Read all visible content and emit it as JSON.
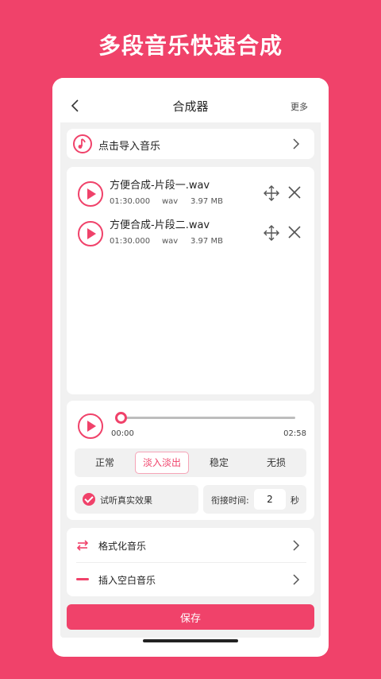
{
  "headline": "多段音乐快速合成",
  "appbar": {
    "title": "合成器",
    "more_label": "更多"
  },
  "import": {
    "label": "点击导入音乐"
  },
  "tracks": [
    {
      "name": "方便合成-片段一.wav",
      "duration": "01:30.000",
      "format": "wav",
      "size": "3.97 MB"
    },
    {
      "name": "方便合成-片段二.wav",
      "duration": "01:30.000",
      "format": "wav",
      "size": "3.97 MB"
    }
  ],
  "player": {
    "current_time": "00:00",
    "total_time": "02:58",
    "progress": 0.0
  },
  "modes": [
    "正常",
    "淡入淡出",
    "稳定",
    "无损"
  ],
  "active_mode": "淡入淡出",
  "preview_label": "试听真实效果",
  "gap": {
    "label": "衔接时间:",
    "value": "2",
    "unit": "秒"
  },
  "menu": [
    {
      "label": "格式化音乐",
      "icon": "swap-arrows-icon"
    },
    {
      "label": "插入空白音乐",
      "icon": "dash-icon"
    }
  ],
  "save_label": "保存",
  "colors": {
    "accent": "#f0426a",
    "background": "#f0426a"
  }
}
